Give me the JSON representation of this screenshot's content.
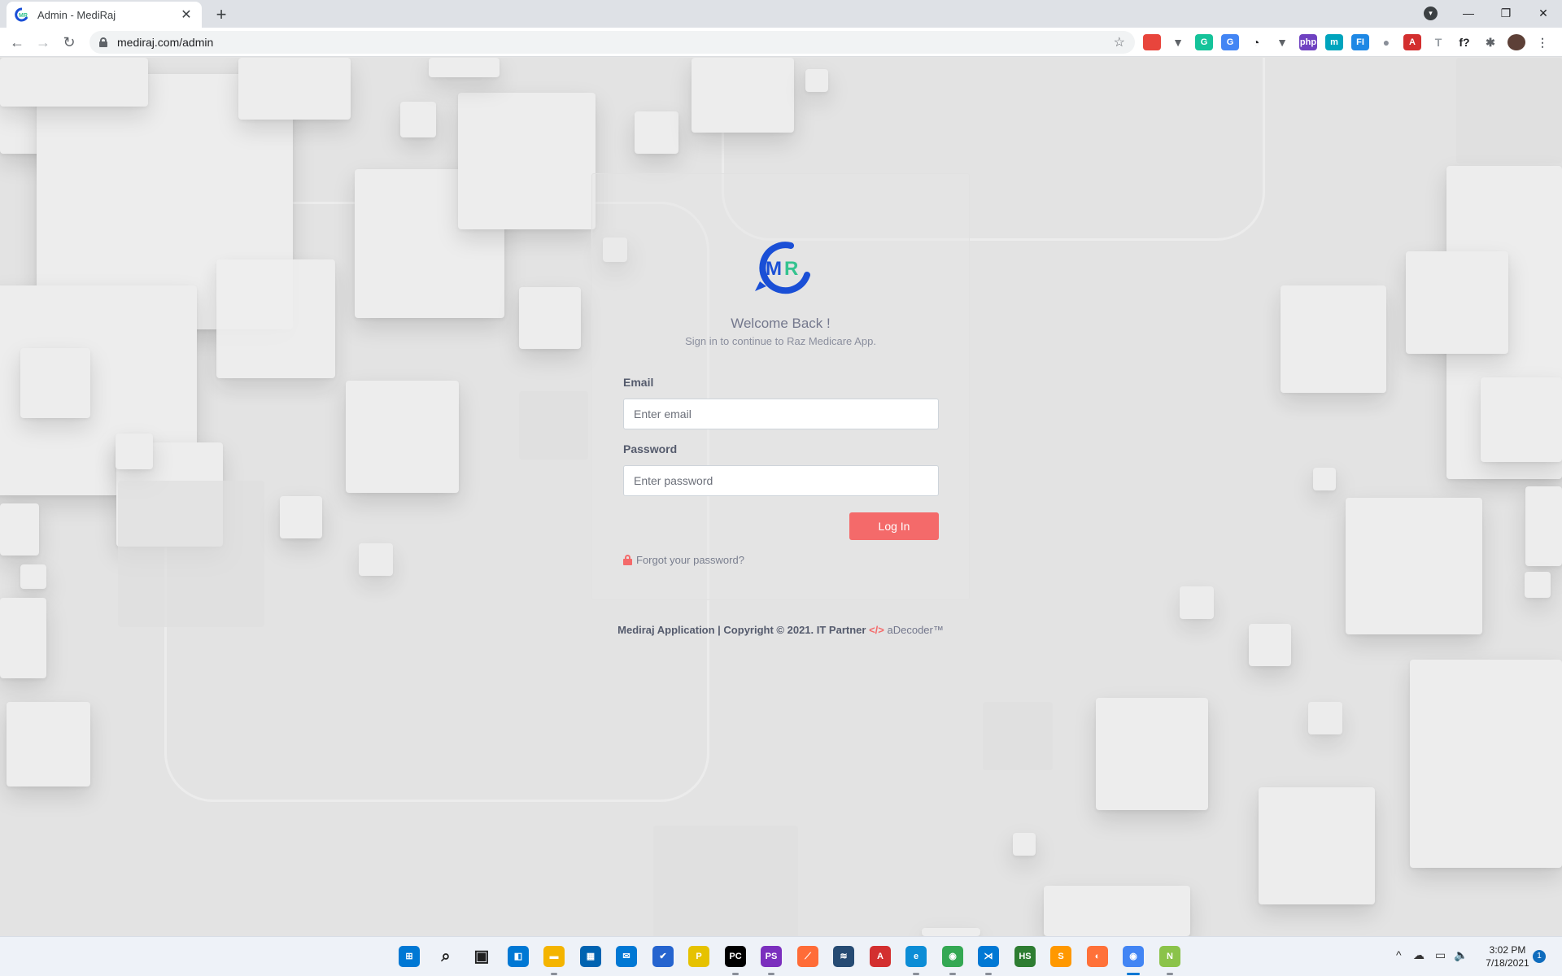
{
  "browser": {
    "tab_title": "Admin - MediRaj",
    "tab_close": "✕",
    "new_tab": "+",
    "url": "mediraj.com/admin",
    "window_controls": [
      "—",
      "❐",
      "✕"
    ],
    "extensions": [
      {
        "icon": "multicolor-extension-icon",
        "label": "",
        "color": "#e8453c"
      },
      {
        "icon": "vue-devtools-icon",
        "label": "▼",
        "color": "#5f6368"
      },
      {
        "icon": "grammarly-icon",
        "label": "G",
        "color": "#15c39a"
      },
      {
        "icon": "google-translate-icon",
        "label": "G",
        "color": "#4285f4"
      },
      {
        "icon": "timer-icon",
        "label": "◔",
        "color": "#202124"
      },
      {
        "icon": "vue-devtools-icon",
        "label": "▼",
        "color": "#5f6368"
      },
      {
        "icon": "php-extension-icon",
        "label": "php",
        "color": "#6f42c1"
      },
      {
        "icon": "m-extension-icon",
        "label": "m",
        "color": "#00a4bd"
      },
      {
        "icon": "fi-extension-icon",
        "label": "FI",
        "color": "#1e88e5"
      },
      {
        "icon": "record-icon",
        "label": "●",
        "color": "#8a8f99"
      },
      {
        "icon": "adobe-acrobat-icon",
        "label": "A",
        "color": "#d32f2f"
      },
      {
        "icon": "font-extension-icon",
        "label": "T",
        "color": "#9aa0a6"
      },
      {
        "icon": "whatfont-icon",
        "label": "f?",
        "color": "#202124"
      },
      {
        "icon": "puzzle-extensions-icon",
        "label": "✱",
        "color": "#5f6368"
      },
      {
        "icon": "profile-avatar-icon",
        "label": "",
        "color": "#5d4037"
      },
      {
        "icon": "more-menu-icon",
        "label": "⋮",
        "color": "#5f6368"
      }
    ]
  },
  "login": {
    "welcome": "Welcome Back !",
    "subtitle": "Sign in to continue to Raz Medicare App.",
    "email_label": "Email",
    "email_placeholder": "Enter email",
    "email_value": "",
    "password_label": "Password",
    "password_placeholder": "Enter password",
    "password_value": "",
    "login_button": "Log In",
    "forgot_link": "Forgot your password?"
  },
  "footer": {
    "text": "Mediraj Application | Copyright © 2021. IT Partner",
    "code_icon": "</>",
    "brand": "aDecoder™"
  },
  "taskbar": {
    "icons": [
      {
        "name": "windows-start-icon",
        "label": "⊞",
        "color": "#0078d4"
      },
      {
        "name": "search-icon",
        "label": "⌕",
        "color": "#1f1f1f"
      },
      {
        "name": "task-view-icon",
        "label": "▣",
        "color": "#1f1f1f"
      },
      {
        "name": "widgets-icon",
        "label": "◧",
        "color": "#0078d4"
      },
      {
        "name": "file-explorer-icon",
        "label": "▬",
        "color": "#f4b400"
      },
      {
        "name": "microsoft-store-icon",
        "label": "▦",
        "color": "#0063b1"
      },
      {
        "name": "mail-icon",
        "label": "✉",
        "color": "#0078d4"
      },
      {
        "name": "todo-icon",
        "label": "✔",
        "color": "#2564cf"
      },
      {
        "name": "paytm-app-icon",
        "label": "P",
        "color": "#e6c200"
      },
      {
        "name": "pycharm-icon",
        "label": "PC",
        "color": "#000000"
      },
      {
        "name": "phpstorm-icon",
        "label": "PS",
        "color": "#7b2fbe"
      },
      {
        "name": "postman-icon",
        "label": "⟋",
        "color": "#ff6c37"
      },
      {
        "name": "mysql-workbench-icon",
        "label": "≋",
        "color": "#264b73"
      },
      {
        "name": "adobe-acrobat-icon",
        "label": "A",
        "color": "#d32f2f"
      },
      {
        "name": "edge-icon",
        "label": "e",
        "color": "#0c8dd6"
      },
      {
        "name": "chrome-profile-icon",
        "label": "◉",
        "color": "#34a853"
      },
      {
        "name": "vscode-icon",
        "label": "⋊",
        "color": "#0078d4"
      },
      {
        "name": "heidisql-icon",
        "label": "HS",
        "color": "#2e7d32"
      },
      {
        "name": "sublime-text-icon",
        "label": "S",
        "color": "#ff9800"
      },
      {
        "name": "firefox-icon",
        "label": "◐",
        "color": "#ff7139"
      },
      {
        "name": "chrome-icon",
        "label": "◉",
        "color": "#4285f4"
      },
      {
        "name": "notepad-plus-icon",
        "label": "N",
        "color": "#8bc34a"
      }
    ],
    "tray": {
      "chevron": "^",
      "cloud": "☁",
      "network": "▭",
      "volume": "🔈"
    },
    "time": "3:02 PM",
    "date": "7/18/2021",
    "notifications": "1"
  },
  "colors": {
    "accent": "#f46a6a",
    "logo_blue": "#1a4fd6",
    "logo_teal": "#34c38f"
  }
}
